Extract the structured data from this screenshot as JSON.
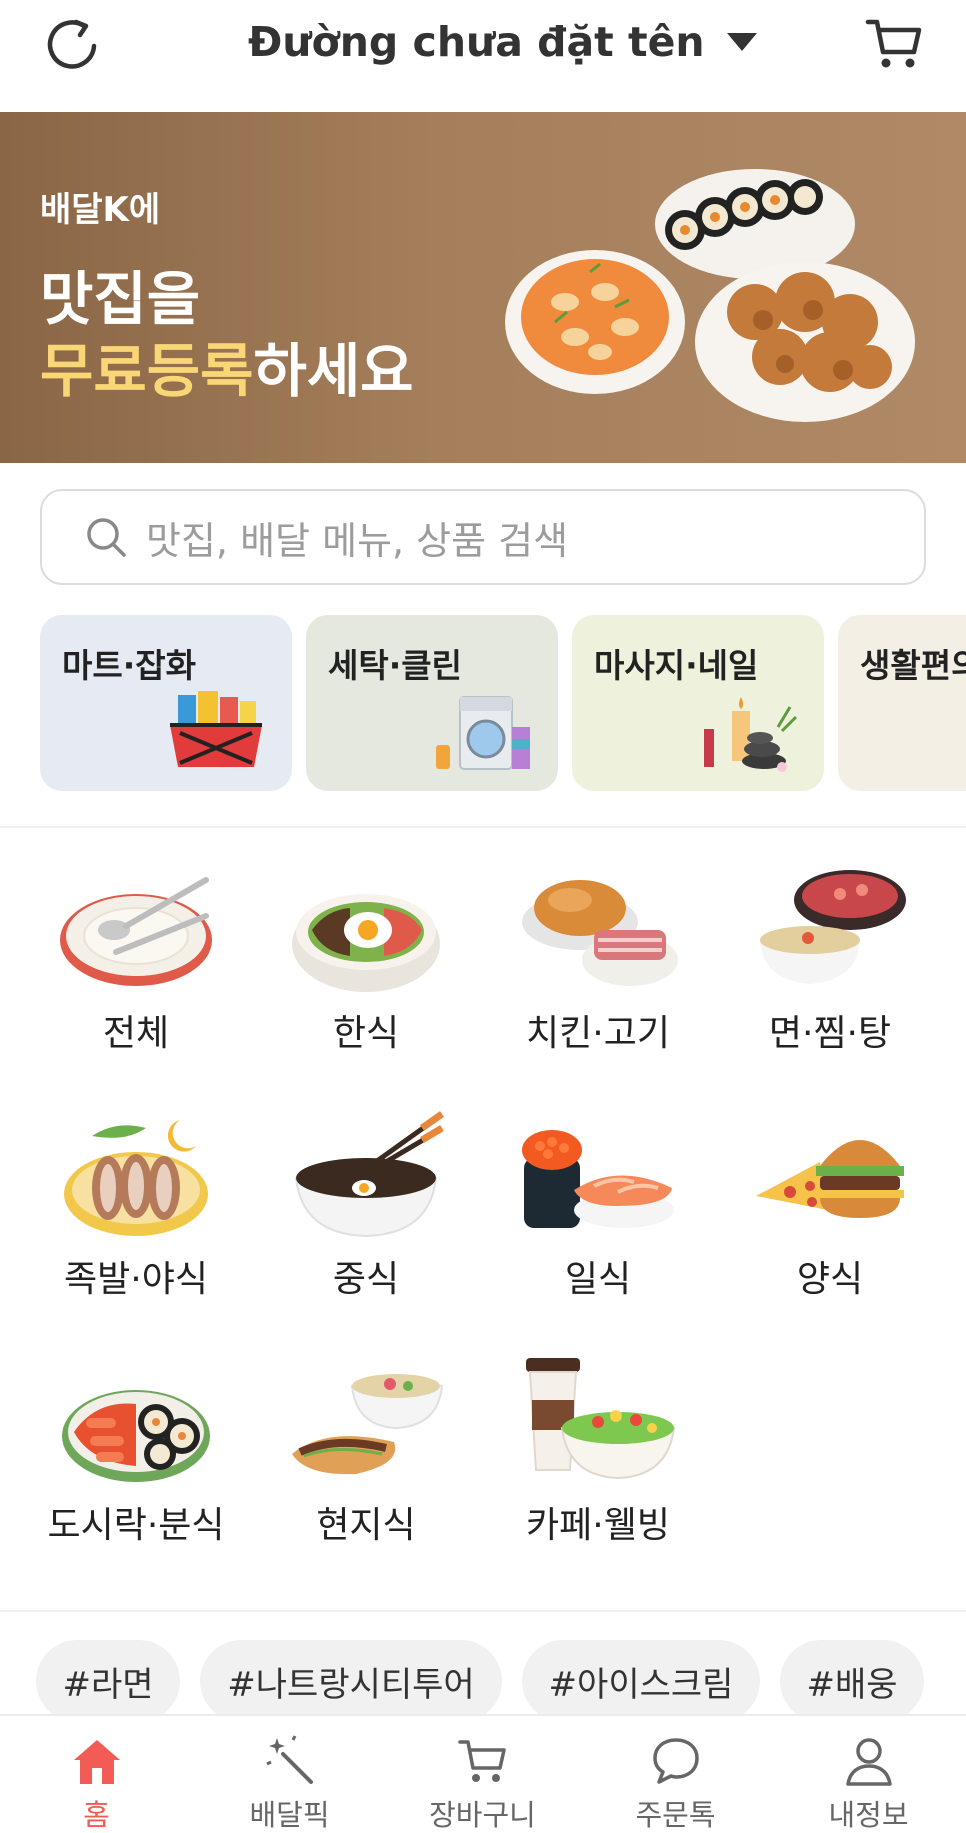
{
  "header": {
    "address": "Đường chưa đặt tên",
    "refresh_icon": "refresh-icon",
    "cart_icon": "cart-icon"
  },
  "banner": {
    "subtitle": "배달K에",
    "line1": "맛집을",
    "line2_highlight": "무료등록",
    "line2_rest": "하세요",
    "highlight_color": "#f9d776"
  },
  "search": {
    "placeholder": "맛집, 배달 메뉴, 상품 검색"
  },
  "services": [
    {
      "label": "마트·잡화",
      "bg": "#e6ebf3",
      "icon": "shopping-basket-icon"
    },
    {
      "label": "세탁·클린",
      "bg": "#e4e8de",
      "icon": "washing-machine-icon"
    },
    {
      "label": "마사지·네일",
      "bg": "#eef1dc",
      "icon": "spa-candles-icon"
    },
    {
      "label": "생활편의",
      "bg": "#f4efe4",
      "icon": "service-icon"
    }
  ],
  "categories": [
    {
      "label": "전체",
      "icon": "plate-cutlery-icon"
    },
    {
      "label": "한식",
      "icon": "bibimbap-icon"
    },
    {
      "label": "치킨·고기",
      "icon": "chicken-meat-icon"
    },
    {
      "label": "면·찜·탕",
      "icon": "noodle-soup-icon"
    },
    {
      "label": "족발·야식",
      "icon": "jokbal-icon"
    },
    {
      "label": "중식",
      "icon": "jajangmyeon-icon"
    },
    {
      "label": "일식",
      "icon": "sushi-icon"
    },
    {
      "label": "양식",
      "icon": "burger-pizza-icon"
    },
    {
      "label": "도시락·분식",
      "icon": "tteokbokki-kimbap-icon"
    },
    {
      "label": "현지식",
      "icon": "pho-banhmi-icon"
    },
    {
      "label": "카페·웰빙",
      "icon": "coffee-salad-icon"
    }
  ],
  "hashtags": [
    "#라면",
    "#나트랑시티투어",
    "#아이스크림",
    "#배웅"
  ],
  "bottom_nav": [
    {
      "label": "홈",
      "icon": "home-icon",
      "active": true
    },
    {
      "label": "배달픽",
      "icon": "magic-wand-icon",
      "active": false
    },
    {
      "label": "장바구니",
      "icon": "cart-icon",
      "active": false
    },
    {
      "label": "주문톡",
      "icon": "chat-icon",
      "active": false
    },
    {
      "label": "내정보",
      "icon": "user-icon",
      "active": false
    }
  ],
  "colors": {
    "accent": "#f25c54",
    "banner_brown": "#9c7653"
  }
}
